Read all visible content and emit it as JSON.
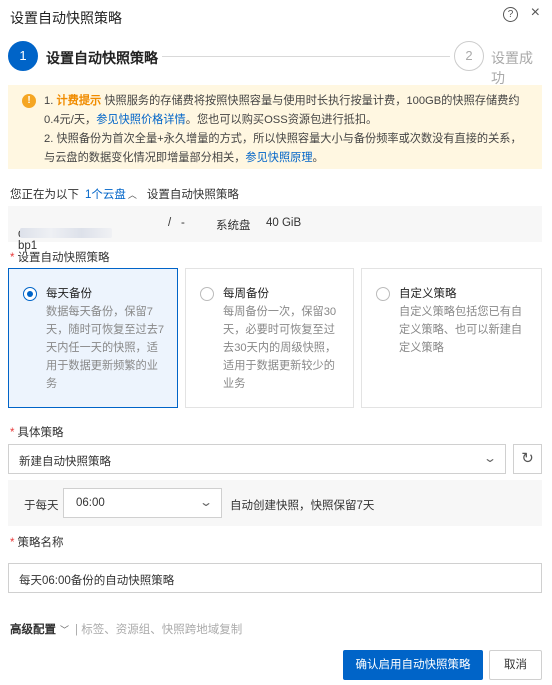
{
  "dialog": {
    "title": "设置自动快照策略",
    "help_icon": "?",
    "close_icon": "×"
  },
  "steps": [
    {
      "num": "1",
      "label": "设置自动快照策略",
      "active": true
    },
    {
      "num": "2",
      "label": "设置成功",
      "active": false
    }
  ],
  "notice": {
    "icon": "!",
    "line1_num": "1. ",
    "line1_highlight": "计费提示",
    "line1_text": " 快照服务的存储费将按照快照容量与使用时长执行按量计费，100GB的快照存储费约0.4元/天，",
    "line1_link": "参见快照价格详情",
    "line1_tail": "。您也可以购买OSS资源包进行抵扣。",
    "line2_text": "2. 快照备份为首次全量+永久增量的方式，所以快照容量大小与备份频率或次数没有直接的关系，与云盘的数据变化情况即增量部分相关，",
    "line2_link": "参见快照原理",
    "line2_tail": "。"
  },
  "location": {
    "prefix": "您正在为以下",
    "disk_link": "1个云盘",
    "arrow": "︿",
    "suffix": "设置自动快照策略"
  },
  "disk": {
    "id_prefix": "d-bp1",
    "sep": "/",
    "dash": "-",
    "type": "系统盘",
    "size": "40 GiB"
  },
  "policy_type": {
    "label": "设置自动快照策略",
    "options": [
      {
        "title": "每天备份",
        "desc": "数据每天备份，保留7天，随时可恢复至过去7天内任一天的快照，适用于数据更新频繁的业务",
        "selected": true
      },
      {
        "title": "每周备份",
        "desc": "每周备份一次，保留30天，必要时可恢复至过去30天内的周级快照，适用于数据更新较少的业务",
        "selected": false
      },
      {
        "title": "自定义策略",
        "desc": "自定义策略包括您已有自定义策略、也可以新建自定义策略",
        "selected": false
      }
    ]
  },
  "specific_policy": {
    "label": "具体策略",
    "value": "新建自动快照策略",
    "refresh_icon": "↻"
  },
  "schedule": {
    "label": "于每天",
    "time": "06:00",
    "tail": "自动创建快照，快照保留7天"
  },
  "policy_name": {
    "label": "策略名称",
    "value": "每天06:00备份的自动快照策略"
  },
  "advanced": {
    "label": "高级配置",
    "chev": "﹀",
    "sub": "| 标签、资源组、快照跨地域复制"
  },
  "buttons": {
    "confirm": "确认启用自动快照策略",
    "cancel": "取消"
  },
  "colors": {
    "accent": "#0064c8",
    "warning_bg": "#fff7e1",
    "warning_text": "#f08c00"
  }
}
